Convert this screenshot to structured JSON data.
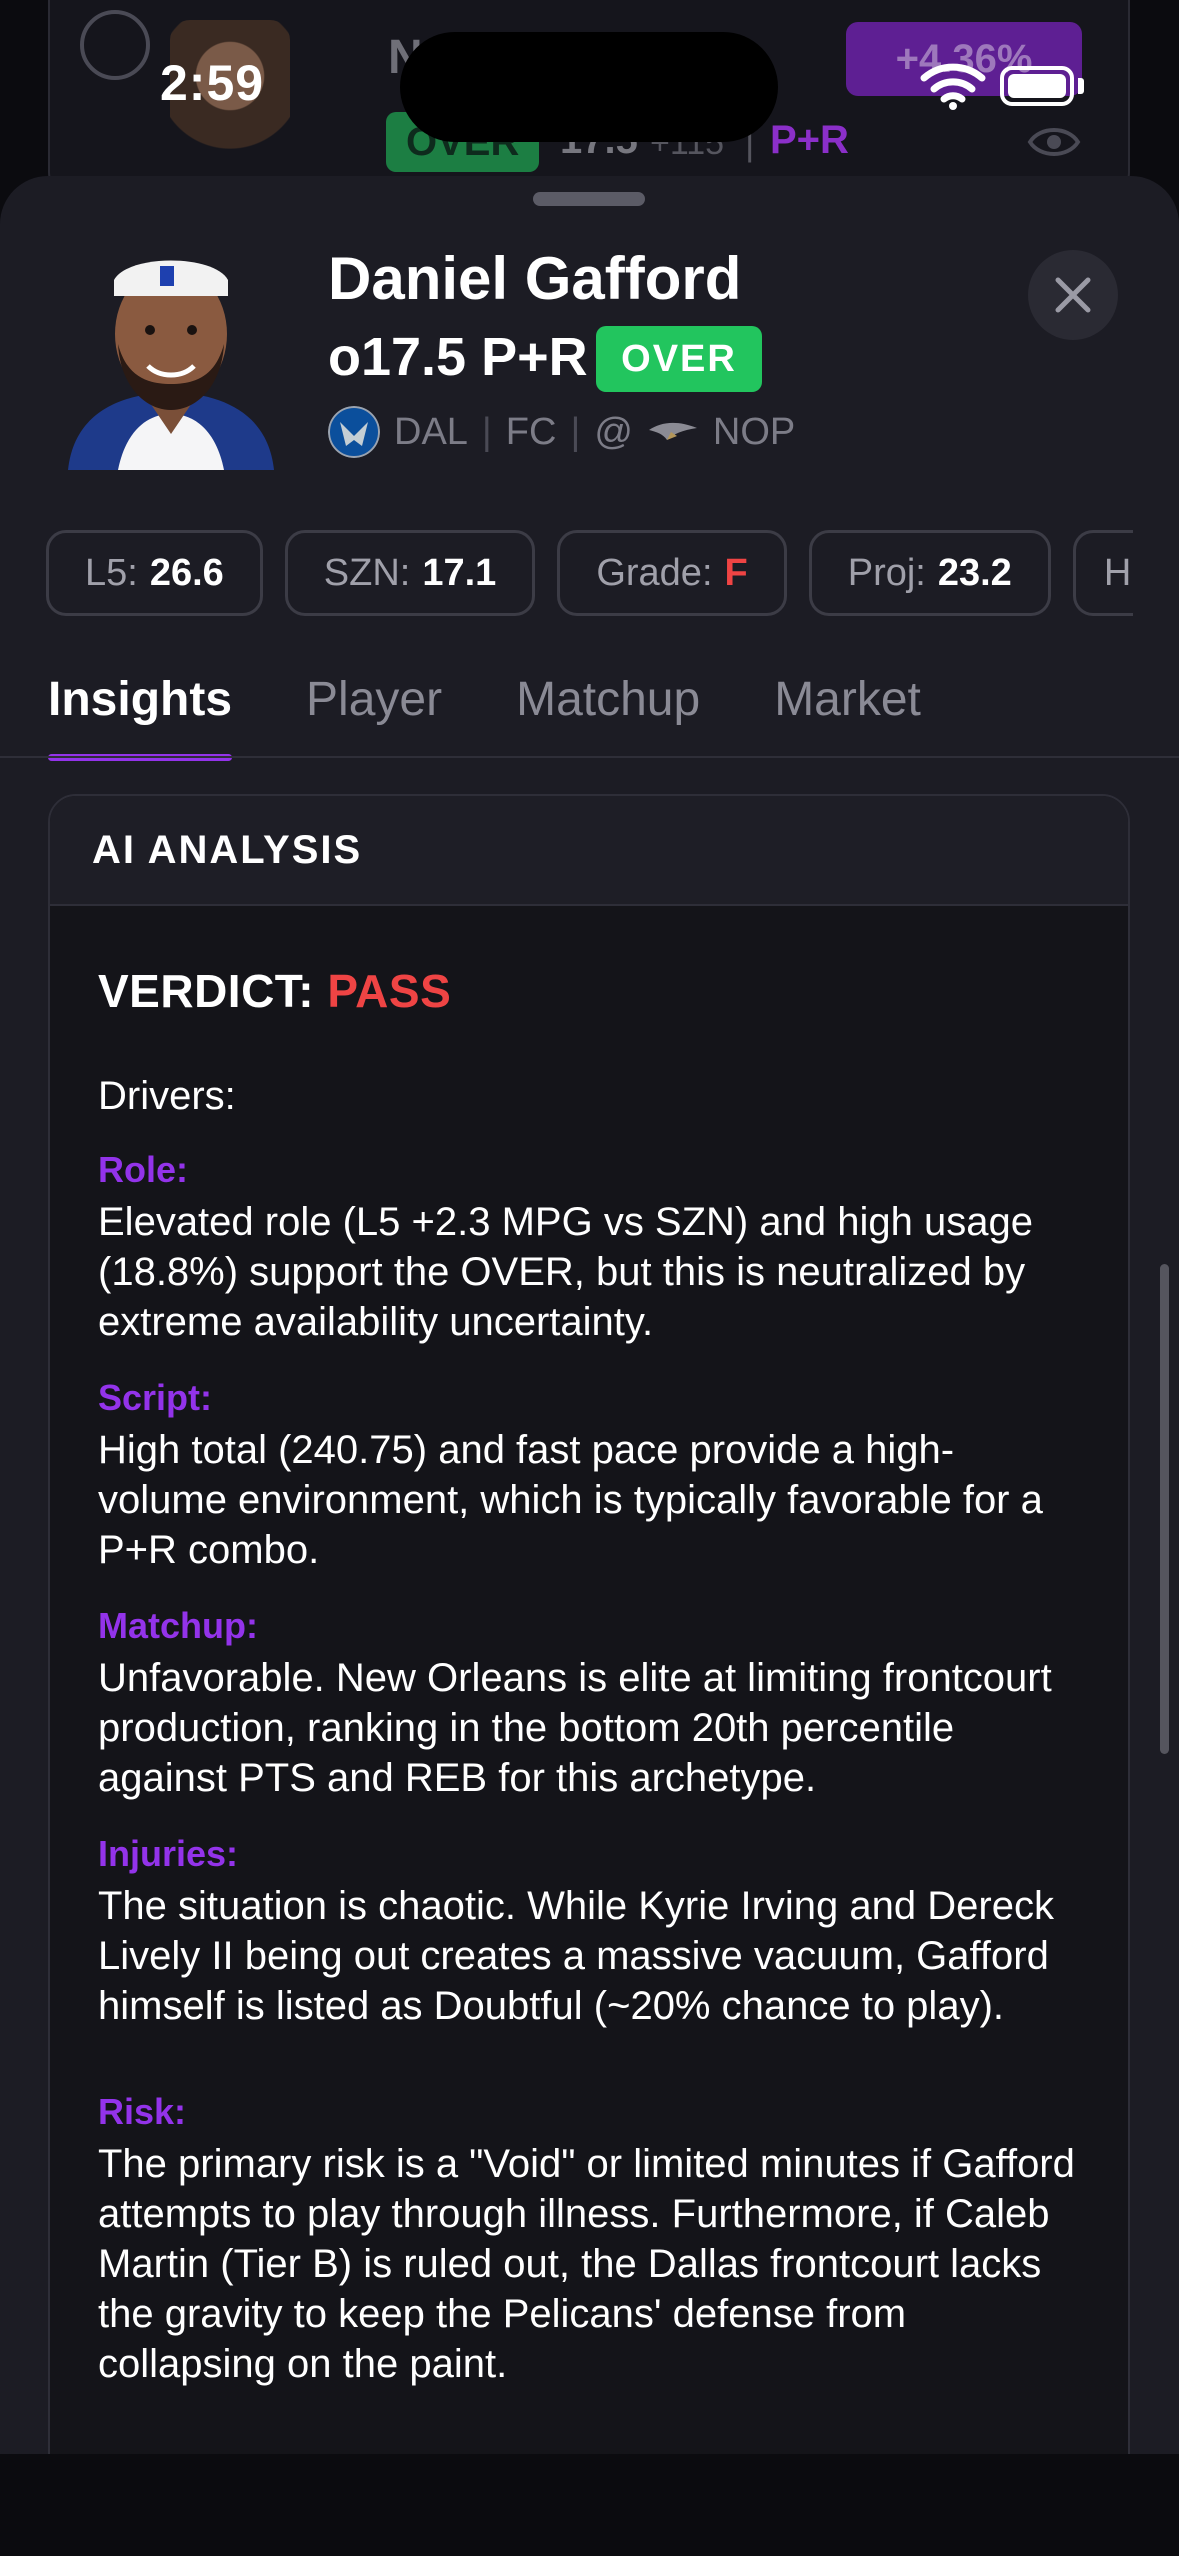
{
  "status_bar": {
    "time": "2:59"
  },
  "background_row": {
    "name_partial": "N",
    "over_label": "OVER",
    "line": "17.5",
    "odds": "+115",
    "separator": "|",
    "prop_type": "P+R",
    "pct_badge": "+4.36%"
  },
  "player": {
    "name": "Daniel Gafford",
    "prop_line": "o17.5 P+R",
    "side_badge": "OVER",
    "team": "DAL",
    "position": "FC",
    "at": "@",
    "opponent": "NOP",
    "separator": "|"
  },
  "stats": [
    {
      "label": "L5:",
      "value": "26.6"
    },
    {
      "label": "SZN:",
      "value": "17.1"
    },
    {
      "label": "Grade:",
      "value": "F"
    },
    {
      "label": "Proj:",
      "value": "23.2"
    },
    {
      "label": "H",
      "value": ""
    }
  ],
  "tabs": [
    {
      "label": "Insights",
      "active": true
    },
    {
      "label": "Player",
      "active": false
    },
    {
      "label": "Matchup",
      "active": false
    },
    {
      "label": "Market",
      "active": false
    }
  ],
  "ai_analysis": {
    "header": "AI ANALYSIS",
    "verdict_label": "VERDICT:",
    "verdict_value": "PASS",
    "drivers_label": "Drivers:",
    "sections": [
      {
        "label": "Role:",
        "text": "Elevated role (L5 +2.3 MPG vs SZN) and high usage (18.8%) support the OVER, but this is neutralized by extreme availability uncertainty."
      },
      {
        "label": "Script:",
        "text": "High total (240.75) and fast pace provide a high-volume environment, which is typically favorable for a P+R combo."
      },
      {
        "label": "Matchup:",
        "text": "Unfavorable. New Orleans is elite at limiting frontcourt production, ranking in the bottom 20th percentile against PTS and REB for this archetype."
      },
      {
        "label": "Injuries:",
        "text": "The situation is chaotic. While Kyrie Irving and Dereck Lively II being out creates a massive vacuum, Gafford himself is listed as Doubtful (~20% chance to play)."
      },
      {
        "label": "Risk:",
        "text": "The primary risk is a \"Void\" or limited minutes if Gafford attempts to play through illness. Furthermore, if Caleb Martin (Tier B) is ruled out, the Dallas frontcourt lacks the gravity to keep the Pelicans' defense from collapsing on the paint."
      }
    ]
  },
  "colors": {
    "accent_purple": "#9333ea",
    "over_green": "#22c55e",
    "pass_red": "#ef4444",
    "sheet_bg": "#1c1c24"
  }
}
